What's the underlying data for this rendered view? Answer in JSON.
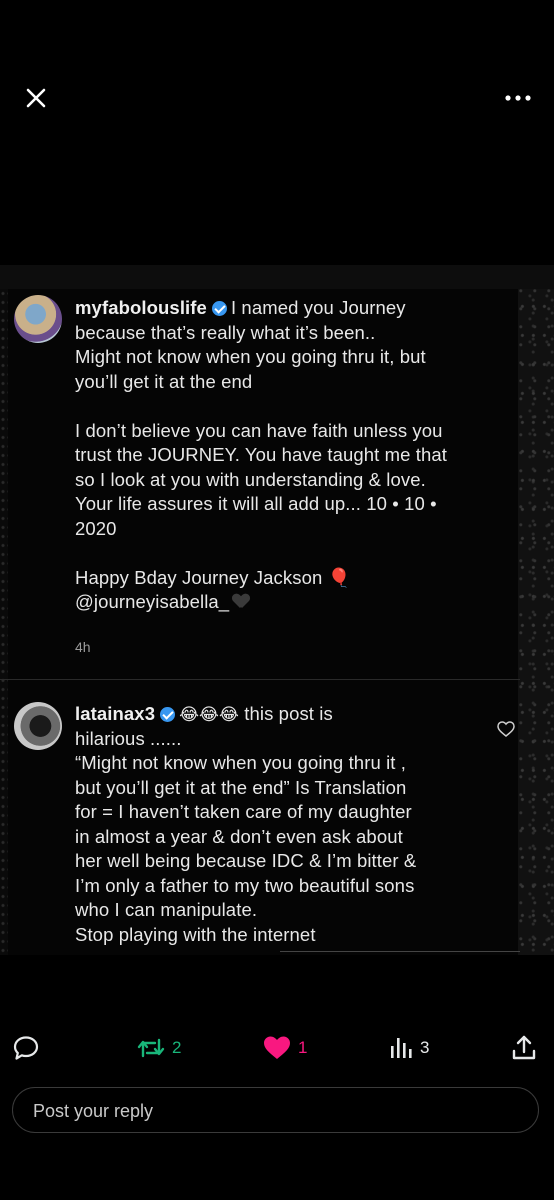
{
  "comments": [
    {
      "username": "myfabolouslife",
      "lines": [
        "I named you Journey",
        "because that’s really what it’s been..",
        "Might not know when you going thru it, but",
        "you’ll get it at the end"
      ],
      "lines2": [
        "I don’t believe you can have faith unless you",
        "trust the JOURNEY.  You have taught me that",
        "so I look at you with understanding & love.",
        "Your life assures it will all add up... 10 • 10 •",
        "2020"
      ],
      "lines3": [
        "Happy Bday Journey Jackson",
        "@journeyisabella_"
      ],
      "balloon": "🎈",
      "time": "4h"
    },
    {
      "username": "latainax3",
      "emojis": "😂😂😂",
      "first_line_rest": "this post is",
      "lines": [
        "hilarious ......",
        "“Might not know when you going thru it ,",
        "but you’ll get it at the end” Is Translation",
        "for = I haven’t taken care of my daughter",
        "in almost a year & don’t even ask about",
        "her well being because IDC & I’m bitter &",
        "I’m only a father to my two beautiful sons",
        "who I can manipulate.",
        "Stop playing with the internet"
      ]
    }
  ],
  "actions": {
    "reposts": "2",
    "likes": "1",
    "views": "3"
  },
  "reply": {
    "placeholder": "Post your reply"
  },
  "colors": {
    "repost": "#19b67a",
    "like": "#f91880",
    "verified": "#3897f0"
  }
}
